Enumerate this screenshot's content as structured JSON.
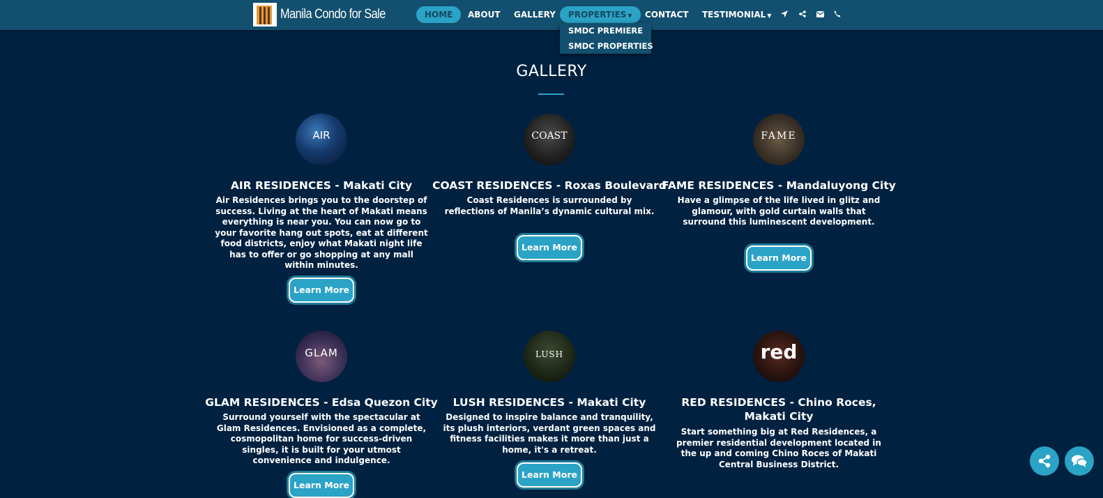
{
  "brand": {
    "name": "Manila Condo for Sale"
  },
  "nav": {
    "home": "HOME",
    "about": "ABOUT",
    "gallery": "GALLERY",
    "properties": "PROPERTIES",
    "contact": "CONTACT",
    "testimonial": "TESTIMONIAL",
    "icons": [
      "location-arrow-icon",
      "share-icon",
      "envelope-icon",
      "phone-icon"
    ]
  },
  "dropdown": {
    "items": [
      "SMDC PREMIERE",
      "SMDC PROPERTIES"
    ]
  },
  "section": {
    "title": "GALLERY"
  },
  "cards": [
    {
      "logo": "AIR",
      "title": "AIR RESIDENCES - Makati City",
      "description": "Air Residences brings you to the doorstep of success. Living at the heart of Makati means everything is near you. You can now go to your favorite hang out spots, eat at different food districts, enjoy what Makati night life has to offer or go shopping at any mall within minutes.",
      "button": "Learn More"
    },
    {
      "logo": "COAST",
      "title": "COAST RESIDENCES - Roxas Boulevard",
      "description": "Coast Residences is surrounded by reflections of Manila’s dynamic cultural mix.",
      "button": "Learn More"
    },
    {
      "logo": "FAME",
      "title": "FAME RESIDENCES - Mandaluyong City",
      "description": "Have a glimpse of the life lived in glitz and glamour, with gold curtain walls that surround this luminescent development.",
      "button": "Learn More"
    },
    {
      "logo": "GLAM",
      "title": "GLAM RESIDENCES - Edsa Quezon City",
      "description": "Surround yourself with the spectacular at Glam Residences. Envisioned as a complete, cosmopolitan home for success-driven singles, it is built for your utmost convenience and indulgence.",
      "button": "Learn More"
    },
    {
      "logo": "LUSH",
      "title": "LUSH RESIDENCES - Makati City",
      "description": "Designed to inspire balance and tranquility, its plush interiors, verdant green spaces and fitness facilities makes it more than just a home, it's a retreat.",
      "button": "Learn More"
    },
    {
      "logo": "red",
      "title": "RED RESIDENCES - Chino Roces, Makati City",
      "description": "Start something big at Red Residences, a premier residential development located in the up and coming Chino Roces of Makati Central Business District.",
      "button": "Learn More"
    }
  ],
  "colors": {
    "background": "#002140",
    "navbar": "#134f6e",
    "accent": "#2aa3c6"
  },
  "floating": {
    "icons": [
      "share-icon",
      "chat-icon"
    ]
  }
}
